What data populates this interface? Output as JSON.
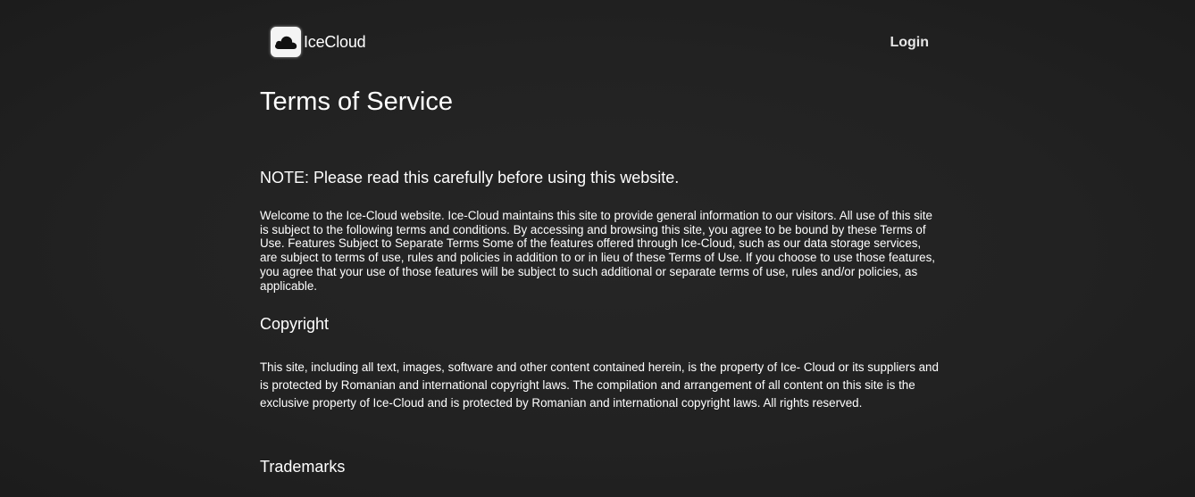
{
  "header": {
    "brand_name": "IceCloud",
    "login_label": "Login",
    "logo_icon": "cloud-icon"
  },
  "main": {
    "title": "Terms of Service",
    "note": "NOTE: Please read this carefully before using this website.",
    "intro": "Welcome to the Ice-Cloud website. Ice-Cloud maintains this site to provide general information to our visitors. All use of this site is subject to the following terms and conditions. By accessing and browsing this site, you agree to be bound by these Terms of Use. Features Subject to Separate Terms Some of the features offered through Ice-Cloud, such as our data storage services, are subject to terms of use, rules and policies in addition to or in lieu of these Terms of Use. If you choose to use those features, you agree that your use of those features will be subject to such additional or separate terms of use, rules and/or policies, as applicable.",
    "copyright_heading": "Copyright",
    "copyright_text": "This site, including all text, images, software and other content contained herein, is the property of Ice- Cloud or its suppliers and is protected by Romanian and international copyright laws. The compilation and arrangement of all content on this site is the exclusive property of Ice-Cloud and is protected by Romanian and international copyright laws. All rights reserved.",
    "trademarks_heading": "Trademarks"
  },
  "colors": {
    "background": "#222222",
    "text": "#ffffff",
    "login": "#e6e6e6"
  }
}
